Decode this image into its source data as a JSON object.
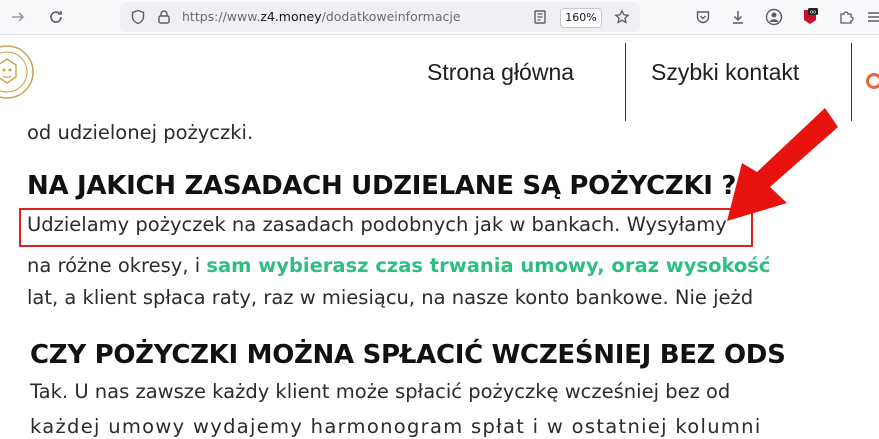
{
  "browser": {
    "url_prefix": "https://www.",
    "url_domain": "z4.money",
    "url_path": "/dodatkoweinformacje",
    "zoom": "160%"
  },
  "nav": {
    "home_label": "Strona główna",
    "contact_label": "Szybki kontakt"
  },
  "content": {
    "line_top": "od udzielonej pożyczki.",
    "heading1": "NA JAKICH ZASADACH UDZIELANE SĄ POŻYCZKI ?",
    "p1_highlight": "Udzielamy pożyczek na zasadach podobnych jak w bankach.",
    "p1_rest": " Wysyłamy",
    "p2_start": "na różne okresy, i ",
    "p2_green": "sam wybierasz czas trwania umowy, oraz wysokość",
    "p3": "lat, a klient spłaca raty, raz w miesiącu, na nasze konto bankowe. Nie jeżd",
    "heading2": "CZY POŻYCZKI MOŻNA SPŁACIĆ WCZEŚNIEJ BEZ ODS",
    "p4": "Tak. U nas zawsze każdy klient może spłacić pożyczkę wcześniej bez od",
    "p5": "każdej umowy wydajemy harmonogram spłat i w ostatniej kolumni"
  },
  "colors": {
    "accent_green": "#2dbe80",
    "highlight_red": "#e0201c",
    "logo_gold": "#c9a24a"
  },
  "icons": [
    "forward-icon",
    "reload-icon",
    "shield-icon",
    "lock-icon",
    "reader-icon",
    "star-icon",
    "pocket-icon",
    "download-icon",
    "account-icon",
    "extension-icon",
    "puzzle-icon",
    "menu-icon"
  ]
}
